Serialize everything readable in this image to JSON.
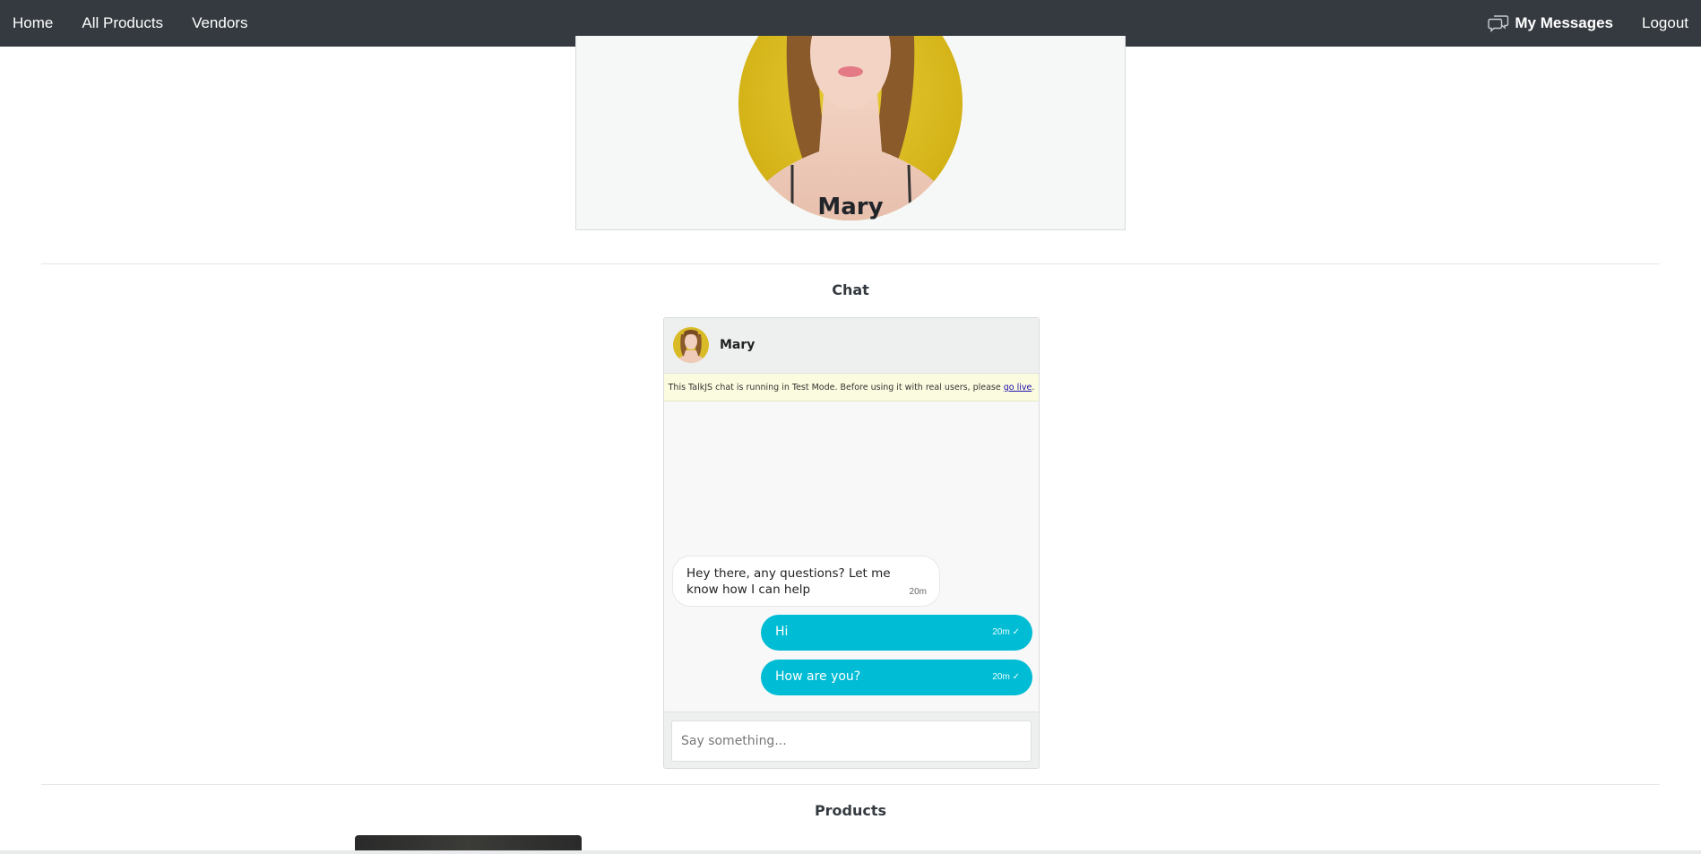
{
  "navbar": {
    "links": [
      {
        "label": "Home"
      },
      {
        "label": "All Products"
      },
      {
        "label": "Vendors"
      }
    ],
    "messages_label": "My Messages",
    "logout_label": "Logout",
    "messages_icon": "chat-bubbles-icon"
  },
  "profile": {
    "name": "Mary"
  },
  "sections": {
    "chat_heading": "Chat",
    "products_heading": "Products"
  },
  "chat": {
    "header_name": "Mary",
    "test_banner_text": "This TalkJS chat is running in Test Mode. Before using it with real users, please",
    "test_banner_link": "go live",
    "test_banner_end": ".",
    "messages": [
      {
        "direction": "in",
        "text": "Hey there, any questions? Let me know how I can help",
        "time": "20m"
      },
      {
        "direction": "out",
        "text": "Hi",
        "time": "20m ✓"
      },
      {
        "direction": "out",
        "text": "How are you?",
        "time": "20m ✓"
      }
    ],
    "input_placeholder": "Say something...",
    "accent_color": "#00bcd4"
  },
  "colors": {
    "navbar_bg": "#343a40",
    "card_bg": "#f6f7f7"
  }
}
